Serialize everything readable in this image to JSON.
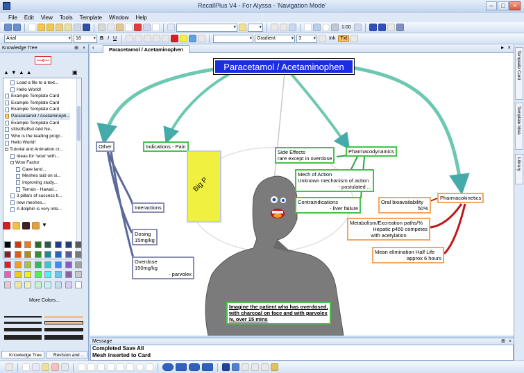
{
  "window": {
    "title": "RecallPlus V4 -  For Alyssa - 'Navigation Mode'",
    "min_label": "–",
    "max_label": "□",
    "close_label": "×"
  },
  "menu": [
    "File",
    "Edit",
    "View",
    "Tools",
    "Template",
    "Window",
    "Help"
  ],
  "toolbar1": {
    "zoom": "1:00"
  },
  "toolbar2": {
    "font": "Arial",
    "size": "18",
    "bold": "B",
    "italic": "I",
    "underline": "U",
    "fill": "Gradient",
    "width": "3",
    "ink": "Ink",
    "txt": "Txt"
  },
  "left_panel": {
    "title": "Knowledge Tree",
    "tree": [
      {
        "label": "Load a file to a text...",
        "depth": 2,
        "type": "doc"
      },
      {
        "label": "Hello World!",
        "depth": 2,
        "type": "doc"
      },
      {
        "label": "Example Template Card",
        "depth": 1,
        "type": "doc"
      },
      {
        "label": "Example Template Card",
        "depth": 1,
        "type": "doc"
      },
      {
        "label": "Example Template Card",
        "depth": 1,
        "type": "doc"
      },
      {
        "label": "Paracetamol / Acetaminoph...",
        "depth": 1,
        "type": "folder"
      },
      {
        "label": "Example Template Card",
        "depth": 1,
        "type": "doc"
      },
      {
        "label": "sfdsdfsdfsd      Add Ne...",
        "depth": 1,
        "type": "doc"
      },
      {
        "label": "Who is the leading progr...",
        "depth": 1,
        "type": "doc"
      },
      {
        "label": "Hello World!",
        "depth": 1,
        "type": "doc"
      },
      {
        "label": "Tutorial and Animation cr...",
        "depth": 1,
        "type": "group"
      },
      {
        "label": "Ideas for 'wow' with...",
        "depth": 2,
        "type": "doc"
      },
      {
        "label": "Wow Factor",
        "depth": 2,
        "type": "group"
      },
      {
        "label": "Cave land...",
        "depth": 3,
        "type": "doc"
      },
      {
        "label": "Meshes laid on si...",
        "depth": 3,
        "type": "doc"
      },
      {
        "label": "Improving study...",
        "depth": 3,
        "type": "doc"
      },
      {
        "label": "Terrain - Hawaii...",
        "depth": 3,
        "type": "doc"
      },
      {
        "label": "3 pillars of success ti...",
        "depth": 2,
        "type": "doc"
      },
      {
        "label": "new meshes...",
        "depth": 2,
        "type": "doc"
      },
      {
        "label": "A dolphin is very inte...",
        "depth": 2,
        "type": "doc"
      }
    ],
    "palette": [
      [
        "#000000",
        "#c83c14",
        "#f0781e",
        "#2d6e1e",
        "#2d5a46",
        "#1e3c8c",
        "#283c78",
        "#5a5a5a"
      ],
      [
        "#8c1e1e",
        "#e65a1e",
        "#b48c1e",
        "#3c8c28",
        "#1e8c8c",
        "#2864c8",
        "#5a5aa0",
        "#787878"
      ],
      [
        "#e61e1e",
        "#f0a01e",
        "#a0c83c",
        "#3cb45a",
        "#3cc8c8",
        "#3c8cf0",
        "#8c5ac8",
        "#a0a0a0"
      ],
      [
        "#f05ab4",
        "#f0c81e",
        "#f0f01e",
        "#50f050",
        "#50f0f0",
        "#64c8f0",
        "#8c64a0",
        "#c8c8c8"
      ],
      [
        "#f0c8c8",
        "#f0e6a0",
        "#f0f0b4",
        "#c8f0c8",
        "#c8f0f0",
        "#c8dcf0",
        "#dcc8f0",
        "#ffffff"
      ]
    ],
    "more_colors": "More Colors...",
    "tabs": [
      "Knowledge Tree",
      "Revision and ..."
    ]
  },
  "document": {
    "tab_label": "Paracetamol / Acetaminophen",
    "root": "Paracetamol / Acetaminophen",
    "nodes": {
      "other": "Other",
      "indications": "Indications - Pain",
      "big_p": "Big P",
      "interactions": "Interactions",
      "dosing": [
        "Dosing",
        "15mg/kg"
      ],
      "overdose": [
        "Overdose",
        "150mg/kg",
        "- parvolex"
      ],
      "side_effects": [
        "Side Effects",
        "rare except in overdose"
      ],
      "pharmacodynamics": "Pharmacodynamics",
      "moa": [
        "Mech of Action",
        "Unknown mechanism of action",
        "- postulated ..."
      ],
      "contraindications": [
        "Contraindications",
        "- liver failure"
      ],
      "pharmacokinetics": "Pharmacokinetics",
      "oral": [
        "Oral bioavailability",
        "50%"
      ],
      "metabolism": [
        "Metabolism/Excreation paths/%",
        "Hepatic p450 competes",
        "with acetylation"
      ],
      "half_life": [
        "Mean elimination Half Life",
        "approx 6 hours"
      ],
      "imagine": [
        "Imagine the patient who has overdosed,",
        "with charcoal on face and with parvolex",
        "iv, over 15 mins"
      ]
    }
  },
  "right_bar": {
    "tabs": [
      "Template Card",
      "Template Idea",
      "Library"
    ]
  },
  "message": {
    "title": "Message",
    "lines": [
      "Completed Save All",
      "Mesh inserted to Card"
    ]
  }
}
